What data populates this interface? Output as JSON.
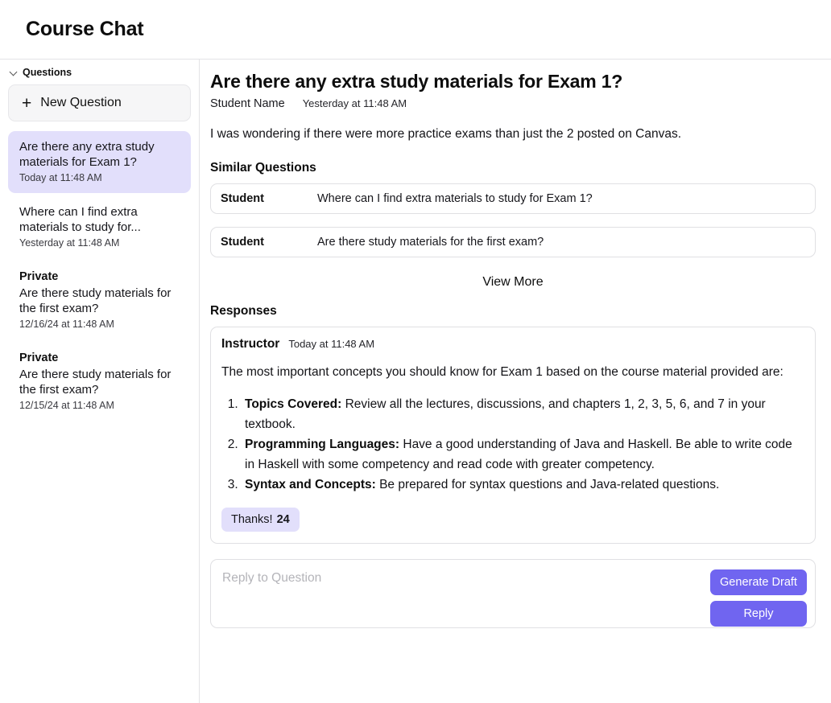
{
  "header": {
    "title": "Course Chat"
  },
  "sidebar": {
    "section_label": "Questions",
    "chevron_icon": "chevron-down-icon",
    "new_question_label": "New Question",
    "plus_icon": "plus-icon",
    "items": [
      {
        "private_label": "",
        "title": "Are there any extra study materials for Exam 1?",
        "time": "Today at 11:48 AM",
        "active": true
      },
      {
        "private_label": "",
        "title": "Where can I find extra materials to study for...",
        "time": "Yesterday at 11:48 AM",
        "active": false
      },
      {
        "private_label": "Private",
        "title": "Are there study materials for the first exam?",
        "time": "12/16/24 at 11:48 AM",
        "active": false
      },
      {
        "private_label": "Private",
        "title": "Are there study materials for the first exam?",
        "time": "12/15/24 at 11:48 AM",
        "active": false
      }
    ]
  },
  "thread": {
    "title": "Are there any extra study materials for Exam 1?",
    "author": "Student Name",
    "time": "Yesterday at 11:48 AM",
    "body": "I was wondering if there were more practice exams than just the 2 posted on Canvas."
  },
  "similar_questions": {
    "heading": "Similar Questions",
    "items": [
      {
        "role": "Student",
        "text": "Where can I find extra materials to study for Exam 1?"
      },
      {
        "role": "Student",
        "text": "Are there study materials for the first exam?"
      }
    ],
    "view_more_label": "View More"
  },
  "responses": {
    "heading": "Responses",
    "items": [
      {
        "role": "Instructor",
        "time": "Today at 11:48 AM",
        "intro": "The most important concepts you should know for Exam 1 based on the course material provided are:",
        "list": [
          {
            "title": "Topics Covered:",
            "text": " Review all the lectures, discussions, and chapters 1, 2, 3, 5, 6, and 7 in your textbook."
          },
          {
            "title": "Programming Languages:",
            "text": " Have a good understanding of Java and Haskell. Be able to write code in Haskell with some competency and read code with greater competency."
          },
          {
            "title": "Syntax and Concepts:",
            "text": " Be prepared for syntax questions and Java-related questions."
          }
        ],
        "thanks_label": "Thanks!",
        "thanks_count": "24"
      }
    ]
  },
  "reply": {
    "placeholder": "Reply to Question",
    "value": "",
    "generate_draft_label": "Generate Draft",
    "reply_label": "Reply"
  },
  "colors": {
    "accent_purple": "#7065f0",
    "highlight_lavender": "#e2dffb",
    "border_gray": "#e0e0e3"
  }
}
